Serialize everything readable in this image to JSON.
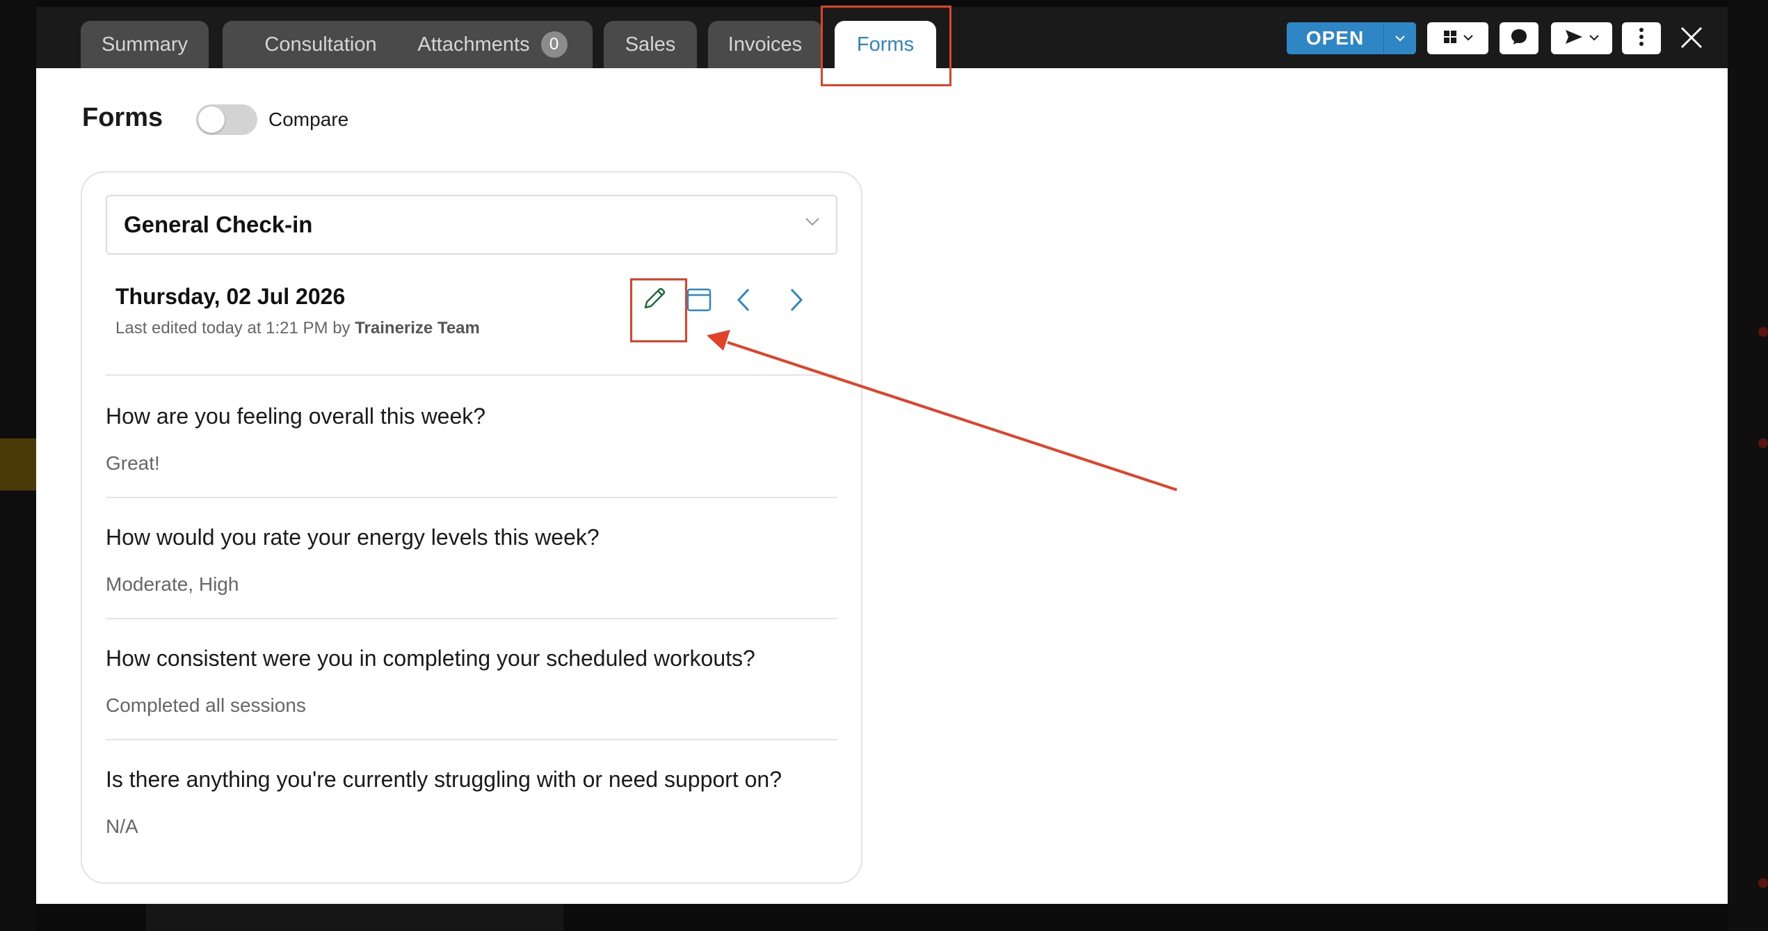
{
  "tabs": [
    {
      "label": "Summary"
    },
    {
      "label": "Consultation"
    },
    {
      "label": "Attachments",
      "count": "0"
    },
    {
      "label": "Sales"
    },
    {
      "label": "Invoices"
    },
    {
      "label": "Forms",
      "active": true
    }
  ],
  "header": {
    "status_button": "OPEN"
  },
  "page": {
    "title": "Forms",
    "compare_label": "Compare",
    "compare_on": false
  },
  "form": {
    "selected": "General Check-in",
    "date": "Thursday, 02 Jul 2026",
    "edited_prefix": "Last edited today at 1:21 PM by",
    "edited_by": "Trainerize Team",
    "questions": [
      {
        "q": "How are you feeling overall this week?",
        "a": "Great!"
      },
      {
        "q": "How would you rate your energy levels this week?",
        "a": "Moderate, High"
      },
      {
        "q": "How consistent were you in completing your scheduled workouts?",
        "a": "Completed all sessions"
      },
      {
        "q": "Is there anything you're currently struggling with or need support on?",
        "a": "N/A"
      }
    ]
  },
  "colors": {
    "accent": "#2f86c4",
    "highlight": "#e0432a",
    "edit_icon": "#1e6b3a"
  },
  "icons": [
    "pencil-icon",
    "calendar-icon",
    "chevron-left-icon",
    "chevron-right-icon",
    "grid-icon",
    "chat-icon",
    "send-icon",
    "more-vertical-icon",
    "close-icon",
    "chevron-down-icon"
  ]
}
